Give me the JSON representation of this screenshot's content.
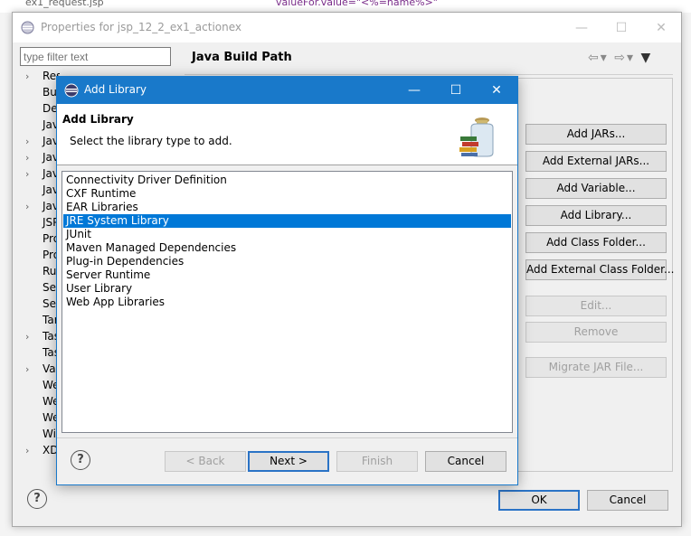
{
  "background": {
    "tab_text": "ex1_request.jsp",
    "code_text": "valueFor.value=\"<%=name%>\""
  },
  "properties": {
    "window_title": "Properties for jsp_12_2_ex1_actionex",
    "filter_placeholder": "type filter text",
    "section_title": "Java Build Path",
    "tree": [
      {
        "label": "Resource",
        "chevron": true
      },
      {
        "label": "Builders",
        "chevron": false
      },
      {
        "label": "Deployment Assembly",
        "chevron": false
      },
      {
        "label": "Java Build Path",
        "chevron": false
      },
      {
        "label": "Java Code Style",
        "chevron": true
      },
      {
        "label": "Java Compiler",
        "chevron": true
      },
      {
        "label": "Java Editor",
        "chevron": true
      },
      {
        "label": "Javadoc Location",
        "chevron": false
      },
      {
        "label": "JavaScript",
        "chevron": true
      },
      {
        "label": "JSP Fragment",
        "chevron": false
      },
      {
        "label": "Project Facets",
        "chevron": false
      },
      {
        "label": "Project References",
        "chevron": false
      },
      {
        "label": "Run/Debug Settings",
        "chevron": false
      },
      {
        "label": "Server",
        "chevron": false
      },
      {
        "label": "Service Policies",
        "chevron": false
      },
      {
        "label": "Targeted Runtimes",
        "chevron": false
      },
      {
        "label": "Task Repository",
        "chevron": true
      },
      {
        "label": "Task Tags",
        "chevron": false
      },
      {
        "label": "Validation",
        "chevron": true
      },
      {
        "label": "Web Content Settings",
        "chevron": false
      },
      {
        "label": "Web Page Editor",
        "chevron": false
      },
      {
        "label": "Web Project Settings",
        "chevron": false
      },
      {
        "label": "WikiText",
        "chevron": false
      },
      {
        "label": "XDoclet",
        "chevron": true
      }
    ],
    "side_buttons": {
      "add_jars": "Add JARs...",
      "add_external_jars": "Add External JARs...",
      "add_variable": "Add Variable...",
      "add_library": "Add Library...",
      "add_class_folder": "Add Class Folder...",
      "add_external_class_folder": "Add External Class Folder...",
      "edit": "Edit...",
      "remove": "Remove",
      "migrate_jar": "Migrate JAR File..."
    },
    "ok_label": "OK",
    "cancel_label": "Cancel",
    "help_glyph": "?"
  },
  "add_library": {
    "window_title": "Add Library",
    "heading": "Add Library",
    "subtitle": "Select the library type to add.",
    "libraries": [
      "Connectivity Driver Definition",
      "CXF Runtime",
      "EAR Libraries",
      "JRE System Library",
      "JUnit",
      "Maven Managed Dependencies",
      "Plug-in Dependencies",
      "Server Runtime",
      "User Library",
      "Web App Libraries"
    ],
    "selected_library": "JRE System Library",
    "back_label": "< Back",
    "next_label": "Next >",
    "finish_label": "Finish",
    "cancel_label": "Cancel",
    "help_glyph": "?"
  },
  "colors": {
    "dialog_titlebar": "#1979ca",
    "selection": "#0078d7",
    "default_button_border": "#2a73c6"
  }
}
